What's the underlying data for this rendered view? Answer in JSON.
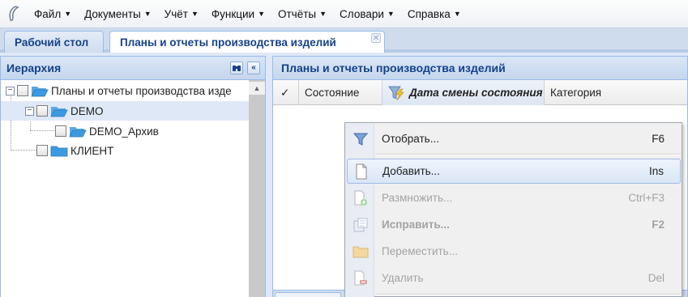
{
  "menubar": {
    "items": [
      {
        "label": "Файл"
      },
      {
        "label": "Документы"
      },
      {
        "label": "Учёт"
      },
      {
        "label": "Функции"
      },
      {
        "label": "Отчёты"
      },
      {
        "label": "Словари"
      },
      {
        "label": "Справка"
      }
    ]
  },
  "tabs": [
    {
      "label": "Рабочий стол",
      "active": false
    },
    {
      "label": "Планы и отчеты производства изделий",
      "active": true
    }
  ],
  "hierarchy": {
    "title": "Иерархия",
    "nodes": [
      {
        "label": "Планы и отчеты производства изде",
        "level": 0,
        "expanded": true
      },
      {
        "label": "DEMO",
        "level": 1,
        "expanded": true,
        "selected": true
      },
      {
        "label": "DEMO_Архив",
        "level": 2
      },
      {
        "label": "КЛИЕНТ",
        "level": 1
      }
    ]
  },
  "main": {
    "title": "Планы и отчеты производства изделий",
    "columns": {
      "check": "✓",
      "state": "Состояние",
      "date": "Дата смены состояния",
      "category": "Категория"
    }
  },
  "context_menu": {
    "items": [
      {
        "label": "Отобрать...",
        "shortcut": "F6",
        "icon": "filter-icon",
        "disabled": false
      },
      {
        "label": "Добавить...",
        "shortcut": "Ins",
        "icon": "new-document-icon",
        "disabled": false
      },
      {
        "label": "Размножить...",
        "shortcut": "Ctrl+F3",
        "icon": "duplicate-icon",
        "disabled": true
      },
      {
        "label": "Исправить...",
        "shortcut": "F2",
        "icon": "edit-icon",
        "disabled": true
      },
      {
        "label": "Переместить...",
        "shortcut": "",
        "icon": "move-folder-icon",
        "disabled": true
      },
      {
        "label": "Удалить",
        "shortcut": "Del",
        "icon": "delete-document-icon",
        "disabled": true
      }
    ]
  },
  "colors": {
    "header_text": "#15428b",
    "panel_border": "#99bbe8",
    "selection": "#dfe8f6",
    "folder": "#3b9be0"
  }
}
